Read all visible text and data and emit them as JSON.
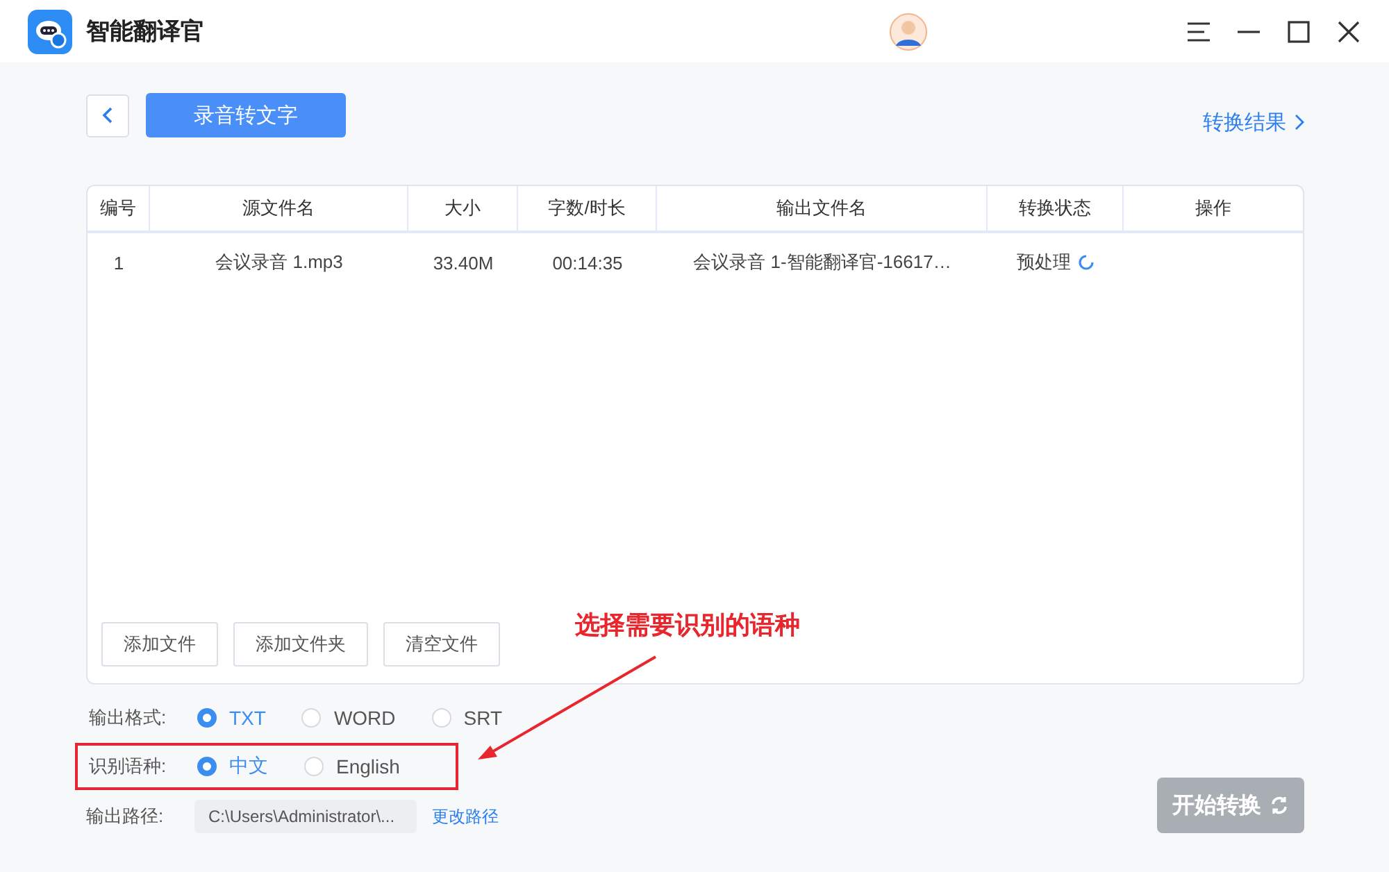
{
  "window": {
    "title": "智能翻译官"
  },
  "header": {
    "mode_tab": "录音转文字",
    "results_link": "转换结果"
  },
  "table": {
    "columns": [
      "编号",
      "源文件名",
      "大小",
      "字数/时长",
      "输出文件名",
      "转换状态",
      "操作"
    ],
    "rows": [
      {
        "cells": [
          "1",
          "会议录音 1.mp3",
          "33.40M",
          "00:14:35",
          "会议录音 1-智能翻译官-16617…"
        ],
        "status": "预处理"
      }
    ]
  },
  "file_buttons": [
    "添加文件",
    "添加文件夹",
    "清空文件"
  ],
  "options": [
    {
      "label": "输出格式:",
      "highlighted": false,
      "choices": [
        {
          "label": "TXT",
          "selected": true
        },
        {
          "label": "WORD",
          "selected": false
        },
        {
          "label": "SRT",
          "selected": false
        }
      ]
    },
    {
      "label": "识别语种:",
      "highlighted": true,
      "choices": [
        {
          "label": "中文",
          "selected": true
        },
        {
          "label": "English",
          "selected": false
        }
      ]
    }
  ],
  "output_path": {
    "label": "输出路径:",
    "value": "C:\\Users\\Administrator\\...",
    "change_link": "更改路径"
  },
  "start_button": {
    "label": "开始转换",
    "disabled": true
  },
  "annotation": {
    "text": "选择需要识别的语种"
  }
}
